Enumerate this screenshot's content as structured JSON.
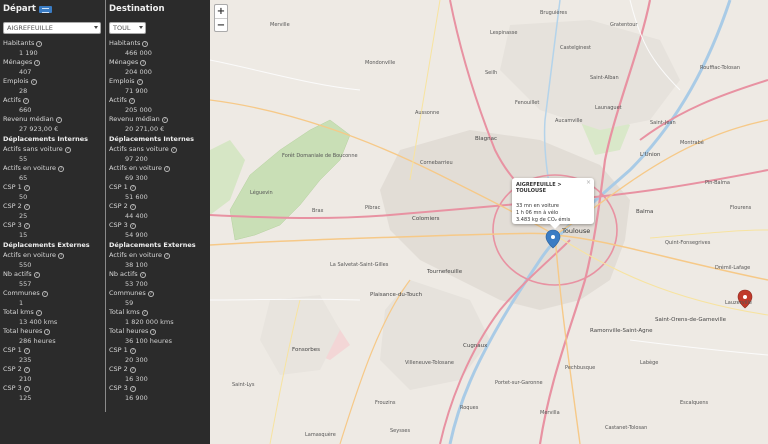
{
  "sidebar": {
    "departure": {
      "title": "Départ",
      "select_value": "AIGREFEUILLE",
      "stats": [
        {
          "label": "Habitants",
          "value": "1 190"
        },
        {
          "label": "Ménages",
          "value": "407"
        },
        {
          "label": "Emplois",
          "value": "28"
        },
        {
          "label": "Actifs",
          "value": "660"
        },
        {
          "label": "Revenu médian",
          "value": "27 923,00 €"
        }
      ],
      "internal_title": "Déplacements Internes",
      "internal": [
        {
          "label": "Actifs sans voiture",
          "value": "55"
        },
        {
          "label": "Actifs en voiture",
          "value": "65"
        },
        {
          "label": "CSP 1",
          "value": "50"
        },
        {
          "label": "CSP 2",
          "value": "25"
        },
        {
          "label": "CSP 3",
          "value": "15"
        }
      ],
      "external_title": "Déplacements Externes",
      "external": [
        {
          "label": "Actifs en voiture",
          "value": "550"
        },
        {
          "label": "Nb actifs",
          "value": "557"
        },
        {
          "label": "Communes",
          "value": "1"
        },
        {
          "label": "Total kms",
          "value": "13 400 kms"
        },
        {
          "label": "Total heures",
          "value": "286 heures"
        },
        {
          "label": "CSP 1",
          "value": "235"
        },
        {
          "label": "CSP 2",
          "value": "210"
        },
        {
          "label": "CSP 3",
          "value": "125"
        }
      ]
    },
    "destination": {
      "title": "Destination",
      "select_value": "TOUL",
      "stats": [
        {
          "label": "Habitants",
          "value": "466 000"
        },
        {
          "label": "Ménages",
          "value": "204 000"
        },
        {
          "label": "Emplois",
          "value": "71 900"
        },
        {
          "label": "Actifs",
          "value": "205 000"
        },
        {
          "label": "Revenu médian",
          "value": "20 271,00 €"
        }
      ],
      "internal_title": "Déplacements Internes",
      "internal": [
        {
          "label": "Actifs sans voiture",
          "value": "97 200"
        },
        {
          "label": "Actifs en voiture",
          "value": "69 300"
        },
        {
          "label": "CSP 1",
          "value": "51 600"
        },
        {
          "label": "CSP 2",
          "value": "44 400"
        },
        {
          "label": "CSP 3",
          "value": "54 900"
        }
      ],
      "external_title": "Déplacements Externes",
      "external": [
        {
          "label": "Actifs en voiture",
          "value": "38 100"
        },
        {
          "label": "Nb actifs",
          "value": "53 700"
        },
        {
          "label": "Communes",
          "value": "59"
        },
        {
          "label": "Total kms",
          "value": "1 820 000 kms"
        },
        {
          "label": "Total heures",
          "value": "36 100 heures"
        },
        {
          "label": "CSP 1",
          "value": "20 300"
        },
        {
          "label": "CSP 2",
          "value": "16 300"
        },
        {
          "label": "CSP 3",
          "value": "16 900"
        }
      ]
    }
  },
  "map": {
    "zoom_in": "+",
    "zoom_out": "−",
    "popup": {
      "title": "AIGREFEUILLE > TOULOUSE",
      "line1": "33 mn en voiture",
      "line2": "1 h 06 mn à vélo",
      "line3": "3.483 kg de CO₂ émis",
      "close": "×"
    },
    "labels": {
      "toulouse": "Toulouse",
      "blagnac": "Blagnac",
      "colomiers": "Colomiers",
      "tournefeuille": "Tournefeuille",
      "plaisance": "Plaisance-du-Touch",
      "balma": "Balma",
      "lunion": "L'Union",
      "ramonville": "Ramonville-Saint-Agne",
      "cugnaux": "Cugnaux",
      "fonsorbes": "Fonsorbes",
      "saint_orens": "Saint-Orens-de-Gameville",
      "foret": "Forêt Domaniale de Bouconne",
      "leguevin": "Léguevin",
      "brax": "Brax",
      "pibrac": "Pibrac",
      "cornebarrieu": "Cornebarrieu",
      "aussonne": "Aussonne",
      "seilh": "Seilh",
      "castelginest": "Castelginest",
      "saint_alban": "Saint-Alban",
      "fenouillet": "Fenouillet",
      "launaguet": "Launaguet",
      "aucamville": "Aucamville",
      "saint_jean": "Saint-Jean",
      "montrabe": "Montrabé",
      "quint": "Quint-Fonsegrives",
      "labege": "Labège",
      "portet": "Portet-sur-Garonne",
      "muret_road": "Roques",
      "villeneuve": "Villeneuve-Tolosane",
      "saint_lys": "Saint-Lys",
      "frouzins": "Frouzins",
      "seysses": "Seysses",
      "lamasquere": "Lamasquère",
      "escalquens": "Escalquens",
      "castanet": "Castanet-Tolosan",
      "la_salvetat": "La Salvetat-Saint-Gilles",
      "mondonville": "Mondonville",
      "grenade": "Merville",
      "bruguieres": "Bruguières",
      "lespinasse": "Lespinasse",
      "gratentour": "Gratentour",
      "rouffiac": "Rouffiac-Tolosan",
      "pin_balma": "Pin-Balma",
      "flourens": "Flourens",
      "drémil": "Drémil-Lafage",
      "lauzerville": "Lauzerville",
      "mervilla": "Mervilla",
      "pechbusque": "Pechbusque"
    }
  },
  "colors": {
    "sidebar_bg": "#2b2b2b",
    "accent": "#3a7cc4",
    "marker_blue": "#3a7cc4",
    "marker_red": "#c0392b"
  }
}
